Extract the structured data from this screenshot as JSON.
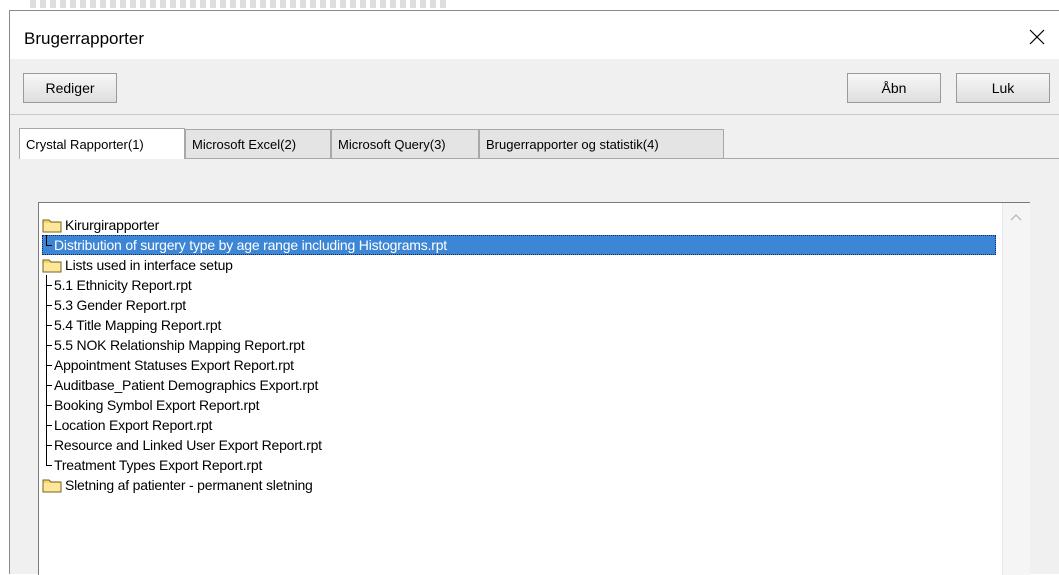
{
  "window": {
    "title": "Brugerrapporter",
    "close_glyph": "✕"
  },
  "toolbar": {
    "edit_label": "Rediger",
    "open_label": "Åbn",
    "close_label": "Luk"
  },
  "tabs": [
    {
      "label": "Crystal Rapporter(1)",
      "active": true
    },
    {
      "label": "Microsoft Excel(2)",
      "active": false
    },
    {
      "label": "Microsoft Query(3)",
      "active": false
    },
    {
      "label": "Brugerrapporter og statistik(4)",
      "active": false
    }
  ],
  "tree": {
    "items": [
      {
        "type": "folder",
        "label": "Kirurgirapporter"
      },
      {
        "type": "file",
        "label": "Distribution of surgery type by age range including Histograms.rpt",
        "selected": true,
        "last": true
      },
      {
        "type": "folder",
        "label": "Lists used in interface setup"
      },
      {
        "type": "file",
        "label": "5.1 Ethnicity Report.rpt"
      },
      {
        "type": "file",
        "label": "5.3 Gender Report.rpt"
      },
      {
        "type": "file",
        "label": "5.4 Title Mapping Report.rpt"
      },
      {
        "type": "file",
        "label": "5.5 NOK Relationship Mapping Report.rpt"
      },
      {
        "type": "file",
        "label": "Appointment Statuses Export Report.rpt"
      },
      {
        "type": "file",
        "label": "Auditbase_Patient Demographics Export.rpt"
      },
      {
        "type": "file",
        "label": "Booking Symbol Export Report.rpt"
      },
      {
        "type": "file",
        "label": "Location Export Report.rpt"
      },
      {
        "type": "file",
        "label": "Resource and Linked User Export Report.rpt"
      },
      {
        "type": "file",
        "label": "Treatment Types Export Report.rpt",
        "last": true
      },
      {
        "type": "folder",
        "label": "Sletning af patienter - permanent sletning"
      }
    ]
  },
  "colors": {
    "selection": "#3d86d6",
    "folder": "#f5d66b"
  },
  "icons": {
    "folder": "folder-icon",
    "close": "close-icon",
    "scroll_up": "chevron-up-icon"
  }
}
